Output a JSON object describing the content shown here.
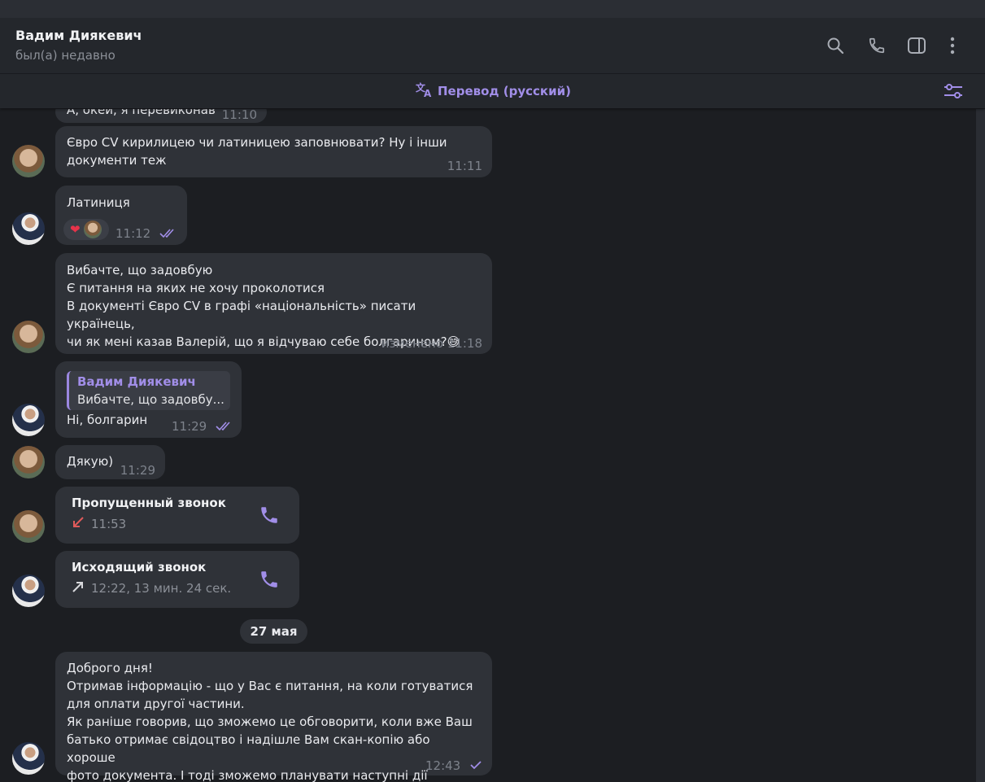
{
  "header": {
    "contact_name": "Вадим Диякевич",
    "status": "был(а) недавно",
    "icons": [
      "search-icon",
      "phone-icon",
      "sidebar-toggle-icon",
      "more-vertical-icon"
    ]
  },
  "translate_bar": {
    "label": "Перевод (русский)",
    "icon": "translate-icon",
    "settings_icon": "filter-settings-icon"
  },
  "colors": {
    "accent": "#a18ee8",
    "bubble": "#2f3238",
    "background": "#1c1e22",
    "missed_call": "#e05a5a"
  },
  "messages": [
    {
      "text": "А, окей, я перевиконав",
      "time": "11:10",
      "partial": true
    },
    {
      "text": "Євро CV кирилицею чи латиницею заповнювати? Ну і інши\nдокументи теж",
      "time": "11:11"
    },
    {
      "text": "Латиниця",
      "time": "11:12",
      "reaction": "❤️",
      "read": true
    },
    {
      "text": "Вибачте, що задовбую\nЄ питання на яких не хочу проколотися\nВ документі Євро CV в графі «національність» писати українець,\nчи як мені казав Валерій, що я відчуваю себе болгарином?😅",
      "time": "изменено 11:18"
    },
    {
      "reply_name": "Вадим Диякевич",
      "reply_text": "Вибачте, що задовбу...",
      "text": "Ні, болгарин",
      "time": "11:29",
      "read": true
    },
    {
      "text": "Дякую)",
      "time": "11:29"
    },
    {
      "call_title": "Пропущенный звонок",
      "call_info": "11:53",
      "call_type": "missed"
    },
    {
      "call_title": "Исходящий звонок",
      "call_info": "12:22, 13 мин. 24 сек.",
      "call_type": "outgoing"
    },
    {
      "text": "Доброго дня!\nОтримав інформацію - що у Вас є питання, на коли готуватися\nдля оплати другої частини.\nЯк раніше говорив, що зможемо це обговорити, коли вже Ваш\nбатько отримає свідоцтво і надішле Вам скан-копію або хороше\nфото документа. І тоді зможемо планувати наступні дії",
      "time": "12:43",
      "sent": true
    }
  ],
  "date_separator": "27 мая"
}
